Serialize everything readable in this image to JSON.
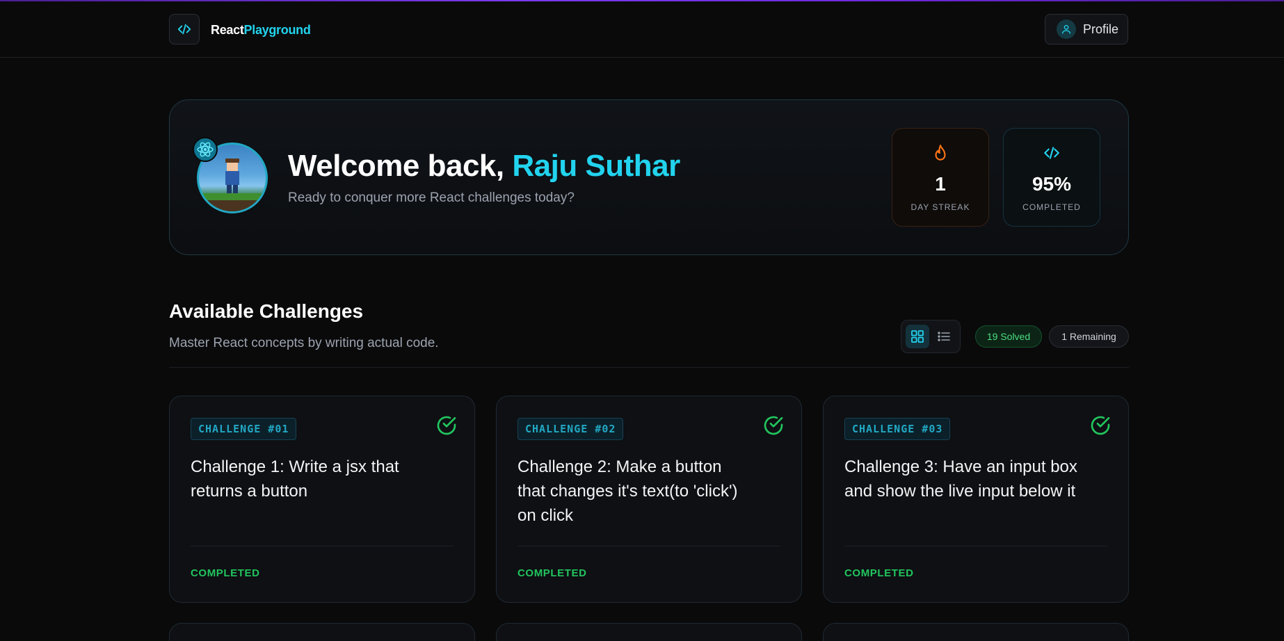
{
  "nav": {
    "logo_part1": "React",
    "logo_part2": "Playground",
    "profile_label": "Profile"
  },
  "hero": {
    "welcome_prefix": "Welcome back,",
    "user_name": "Raju Suthar",
    "subtitle": "Ready to conquer more React challenges today?",
    "stats": {
      "streak_value": "1",
      "streak_label": "DAY STREAK",
      "completed_value": "95%",
      "completed_label": "COMPLETED"
    }
  },
  "challenges_section": {
    "title": "Available Challenges",
    "subtitle": "Master React concepts by writing actual code.",
    "solved_badge": "19 Solved",
    "remaining_badge": "1 Remaining",
    "view_mode": "grid"
  },
  "cards": [
    {
      "tag": "CHALLENGE #01",
      "title": "Challenge 1: Write a jsx that returns a button",
      "status": "COMPLETED"
    },
    {
      "tag": "CHALLENGE #02",
      "title": "Challenge 2: Make a button that changes it's text(to 'click') on click",
      "status": "COMPLETED"
    },
    {
      "tag": "CHALLENGE #03",
      "title": "Challenge 3: Have an input box and show the live input below it",
      "status": "COMPLETED"
    }
  ],
  "colors": {
    "accent": "#22d3ee",
    "success": "#22c55e",
    "streak": "#f97316",
    "background": "#0a0a0b"
  }
}
